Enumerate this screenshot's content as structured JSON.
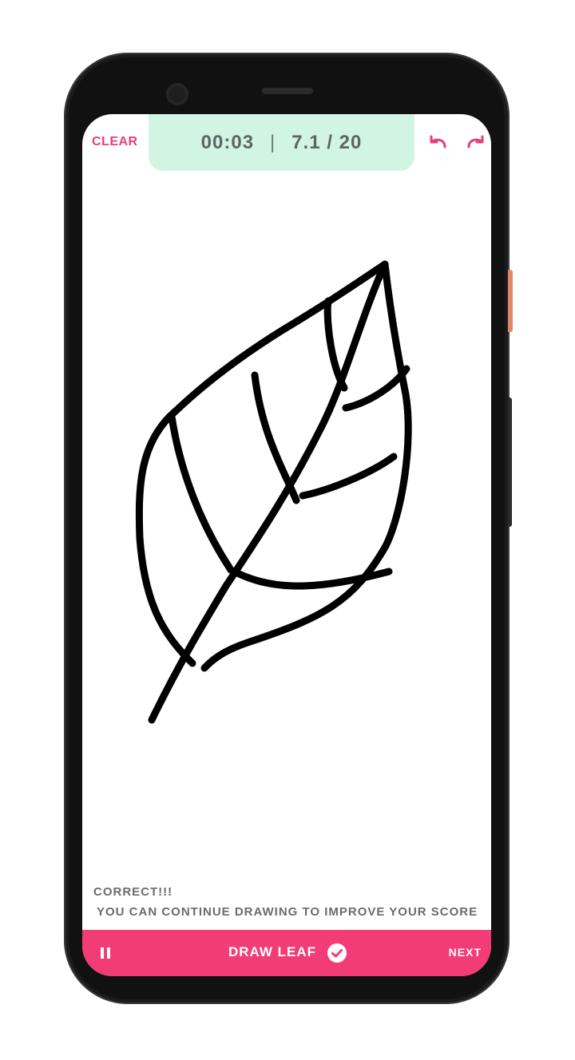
{
  "toolbar": {
    "clear_label": "CLEAR",
    "timer": "00:03",
    "separator": "|",
    "score": "7.1 / 20",
    "undo_icon": "undo-arrow-icon",
    "redo_icon": "redo-arrow-icon"
  },
  "feedback": {
    "title": "CORRECT!!!",
    "message": "YOU CAN CONTINUE DRAWING TO IMPROVE YOUR SCORE"
  },
  "bottom_bar": {
    "pause_icon": "pause-icon",
    "task_label": "DRAW LEAF",
    "check_icon": "check-circle-icon",
    "next_label": "NEXT"
  },
  "colors": {
    "accent": "#f23c78",
    "pill_bg": "#d2f5e3",
    "text_muted": "#6b6b6b"
  }
}
